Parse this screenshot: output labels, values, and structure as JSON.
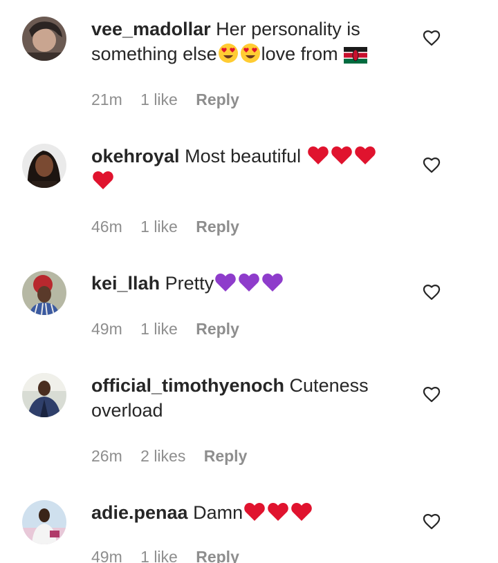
{
  "comments": [
    {
      "username": "vee_madollar",
      "text_1": "Her personality is something else",
      "text_2": "love from",
      "time": "21m",
      "likes": "1 like",
      "reply": "Reply",
      "emojis": [
        "heart-eyes-emoji",
        "heart-eyes-emoji",
        "kenya-flag-emoji"
      ]
    },
    {
      "username": "okehroyal",
      "text_1": "Most beautiful",
      "time": "46m",
      "likes": "1 like",
      "reply": "Reply",
      "emojis": [
        "red-heart-emoji",
        "red-heart-emoji",
        "red-heart-emoji",
        "red-heart-emoji"
      ]
    },
    {
      "username": "kei_llah",
      "text_1": "Pretty",
      "time": "49m",
      "likes": "1 like",
      "reply": "Reply",
      "emojis": [
        "purple-heart-emoji",
        "purple-heart-emoji",
        "purple-heart-emoji"
      ]
    },
    {
      "username": "official_timothyenoch",
      "text_1": "Cuteness overload",
      "time": "26m",
      "likes": "2 likes",
      "reply": "Reply"
    },
    {
      "username": "adie.penaa",
      "text_1": "Damn",
      "time": "49m",
      "likes": "1 like",
      "reply": "Reply",
      "emojis": [
        "red-heart-emoji",
        "red-heart-emoji",
        "red-heart-emoji"
      ]
    }
  ],
  "colors": {
    "text": "#262626",
    "meta": "#8e8e8e",
    "heart_red": "#e0132e",
    "heart_purple": "#8e3ccb"
  }
}
